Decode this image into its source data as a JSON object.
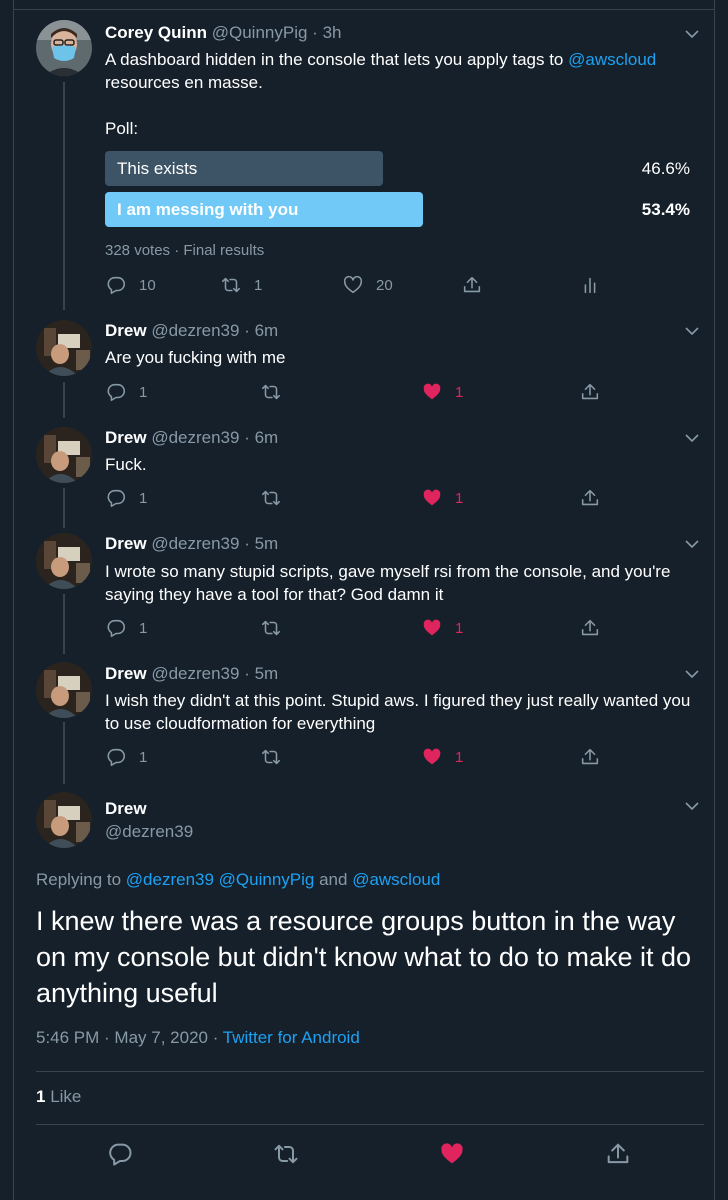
{
  "tweets": [
    {
      "name": "Corey Quinn",
      "handle": "@QuinnyPig",
      "time": "3h",
      "text_before": "A dashboard hidden in the console that lets you apply tags to ",
      "text_link": "@awscloud",
      "text_after": " resources en masse.",
      "poll": {
        "label": "Poll:",
        "options": [
          {
            "label": "This exists",
            "percent": "46.6%"
          },
          {
            "label": "I am messing with you",
            "percent": "53.4%"
          }
        ],
        "meta": "328 votes · Final results"
      },
      "replies": "10",
      "retweets": "1",
      "likes": "20",
      "avatar_icon": "person-mask-avatar"
    },
    {
      "name": "Drew",
      "handle": "@dezren39",
      "time": "6m",
      "text": "Are you fucking with me",
      "replies": "1",
      "likes": "1"
    },
    {
      "name": "Drew",
      "handle": "@dezren39",
      "time": "6m",
      "text": "Fuck.",
      "replies": "1",
      "likes": "1"
    },
    {
      "name": "Drew",
      "handle": "@dezren39",
      "time": "5m",
      "text": "I wrote so many stupid scripts, gave myself rsi from the console, and you're saying they have a tool for that? God damn it",
      "replies": "1",
      "likes": "1"
    },
    {
      "name": "Drew",
      "handle": "@dezren39",
      "time": "5m",
      "text": "I wish they didn't at this point. Stupid aws. I figured they just really wanted you to use cloudformation for everything",
      "replies": "1",
      "likes": "1"
    }
  ],
  "focus": {
    "name": "Drew",
    "handle": "@dezren39",
    "replying_prefix": "Replying to ",
    "replying_user1": "@dezren39",
    "replying_user2": "@QuinnyPig",
    "replying_and": " and ",
    "replying_user3": "@awscloud",
    "text": "I knew there was a resource groups button in the way on my console but didn't know what to do to make it do anything useful",
    "time": "5:46 PM · May 7, 2020 · ",
    "source": "Twitter for Android",
    "like_count": "1",
    "like_word": " Like"
  },
  "colors": {
    "background": "#15202b",
    "accent": "#1da1f2",
    "like": "#e0245e",
    "muted": "#8899a6",
    "poll_winner": "#71c9f8",
    "poll_loser": "#3d5466"
  }
}
